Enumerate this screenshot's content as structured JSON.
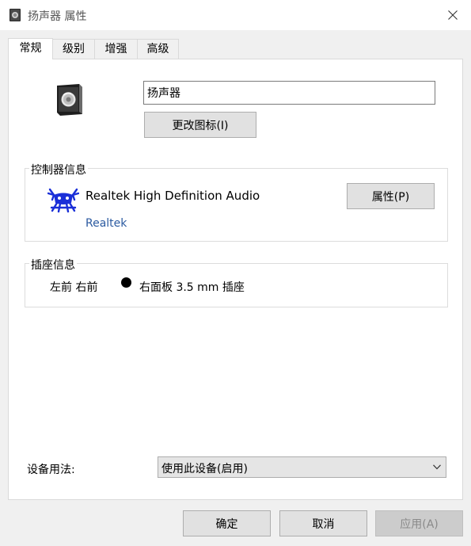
{
  "window": {
    "title": "扬声器 属性",
    "close_icon": "close-icon"
  },
  "tabs": [
    {
      "label": "常规",
      "active": true
    },
    {
      "label": "级别",
      "active": false
    },
    {
      "label": "增强",
      "active": false
    },
    {
      "label": "高级",
      "active": false
    }
  ],
  "general": {
    "device_icon": "speaker-icon",
    "device_name_value": "扬声器",
    "change_icon_label": "更改图标(I)"
  },
  "controller": {
    "group_label": "控制器信息",
    "logo_icon": "realtek-logo-icon",
    "device_name": "Realtek High Definition Audio",
    "manufacturer_link": "Realtek",
    "properties_label": "属性(P)"
  },
  "jack": {
    "group_label": "插座信息",
    "position": "左前 右前",
    "color_icon": "jack-color-dot",
    "description": "右面板 3.5 mm 插座"
  },
  "usage": {
    "label": "设备用法:",
    "selected": "使用此设备(启用)"
  },
  "footer": {
    "ok_label": "确定",
    "cancel_label": "取消",
    "apply_label": "应用(A)"
  }
}
